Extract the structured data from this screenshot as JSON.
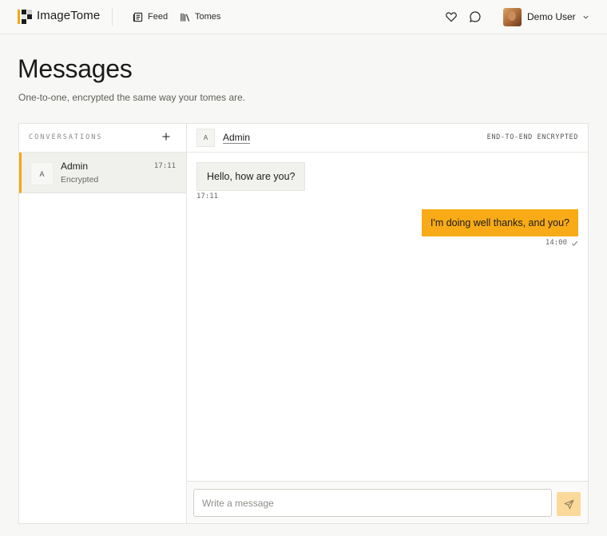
{
  "app": {
    "name": "ImageTome"
  },
  "nav": {
    "feed_label": "Feed",
    "tomes_label": "Tomes"
  },
  "user": {
    "name": "Demo User"
  },
  "page": {
    "title": "Messages",
    "subtitle": "One-to-one, encrypted the same way your tomes are."
  },
  "sidebar": {
    "header": "CONVERSATIONS",
    "conversations": [
      {
        "initial": "A",
        "name": "Admin",
        "status": "Encrypted",
        "time": "17:11",
        "selected": true
      }
    ]
  },
  "chat": {
    "contact_initial": "A",
    "contact_name": "Admin",
    "encryption_label": "END-TO-END ENCRYPTED",
    "messages": [
      {
        "direction": "incoming",
        "text": "Hello, how are you?",
        "time": "17:11"
      },
      {
        "direction": "outgoing",
        "text": "I'm doing well thanks, and you?",
        "time": "14:00",
        "read": true
      }
    ],
    "composer": {
      "placeholder": "Write a message"
    }
  },
  "colors": {
    "accent": "#f8ab16",
    "accent_light": "#fbd99a",
    "selected_bg": "#f0f0ec"
  },
  "icons": [
    "logo-icon",
    "feed-icon",
    "tomes-icon",
    "heart-icon",
    "chat-bubble-icon",
    "chevron-down-icon",
    "plus-icon",
    "check-icon",
    "send-icon"
  ]
}
